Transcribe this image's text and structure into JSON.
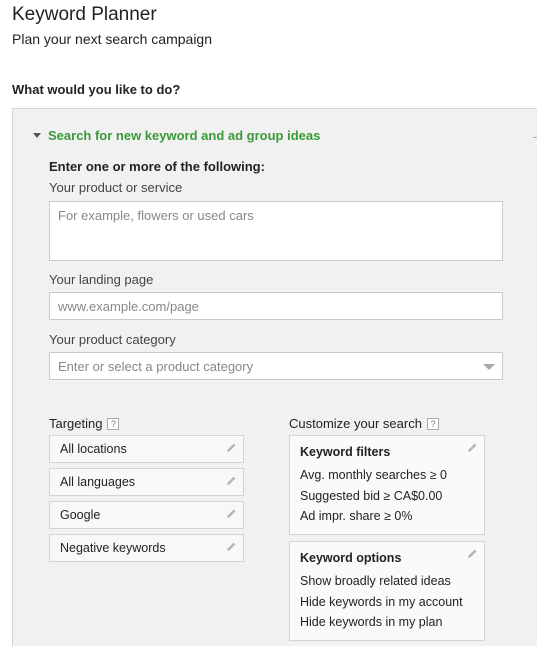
{
  "header": {
    "title": "Keyword Planner",
    "subtitle": "Plan your next search campaign"
  },
  "question": "What would you like to do?",
  "section": {
    "title": "Search for new keyword and ad group ideas",
    "instruction": "Enter one or more of the following:",
    "product": {
      "label": "Your product or service",
      "placeholder": "For example, flowers or used cars"
    },
    "landing": {
      "label": "Your landing page",
      "placeholder": "www.example.com/page"
    },
    "category": {
      "label": "Your product category",
      "placeholder": "Enter or select a product category"
    },
    "targeting": {
      "label": "Targeting",
      "help": "?",
      "items": [
        "All locations",
        "All languages",
        "Google",
        "Negative keywords"
      ]
    },
    "customize": {
      "label": "Customize your search",
      "help": "?",
      "filters": {
        "title": "Keyword filters",
        "lines": [
          "Avg. monthly searches ≥ 0",
          "Suggested bid ≥ CA$0.00",
          "Ad impr. share ≥ 0%"
        ]
      },
      "options": {
        "title": "Keyword options",
        "lines": [
          "Show broadly related ideas",
          "Hide keywords in my account",
          "Hide keywords in my plan"
        ]
      }
    }
  }
}
